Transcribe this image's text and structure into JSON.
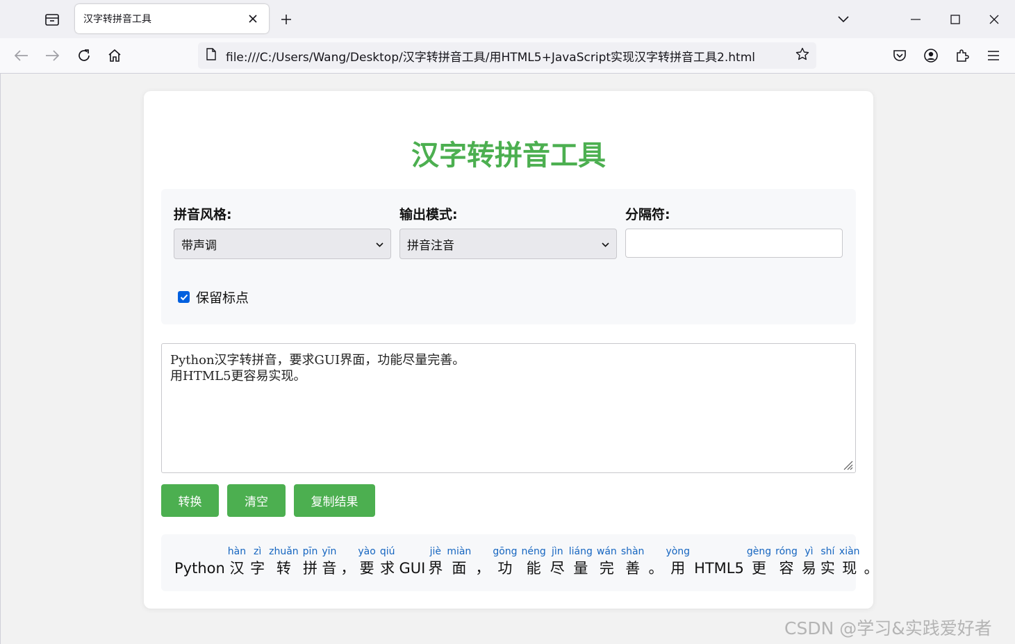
{
  "browser": {
    "tab_title": "汉字转拼音工具",
    "url": "file:///C:/Users/Wang/Desktop/汉字转拼音工具/用HTML5+JavaScript实现汉字转拼音工具2.html"
  },
  "app": {
    "title": "汉字转拼音工具",
    "style_label": "拼音风格:",
    "style_value": "带声调",
    "mode_label": "输出模式:",
    "mode_value": "拼音注音",
    "separator_label": "分隔符:",
    "separator_value": "",
    "keep_punct_label": "保留标点",
    "keep_punct_checked": true,
    "input_text": "Python汉字转拼音，要求GUI界面，功能尽量完善。\n用HTML5更容易实现。",
    "convert_button": "转换",
    "clear_button": "清空",
    "copy_button": "复制结果",
    "result": [
      {
        "t": "Python"
      },
      {
        "h": "汉",
        "p": "hàn"
      },
      {
        "h": "字",
        "p": "zì"
      },
      {
        "h": "转",
        "p": "zhuǎn"
      },
      {
        "h": "拼",
        "p": "pīn"
      },
      {
        "h": "音",
        "p": "yīn"
      },
      {
        "t": "，"
      },
      {
        "h": "要",
        "p": "yào"
      },
      {
        "h": "求",
        "p": "qiú"
      },
      {
        "t": "GUI"
      },
      {
        "h": "界",
        "p": "jiè"
      },
      {
        "h": "面",
        "p": "miàn"
      },
      {
        "t": "，"
      },
      {
        "h": "功",
        "p": "gōng"
      },
      {
        "h": "能",
        "p": "néng"
      },
      {
        "h": "尽",
        "p": "jìn"
      },
      {
        "h": "量",
        "p": "liáng"
      },
      {
        "h": "完",
        "p": "wán"
      },
      {
        "h": "善",
        "p": "shàn"
      },
      {
        "t": "。"
      },
      {
        "h": "用",
        "p": "yòng"
      },
      {
        "t": "HTML5"
      },
      {
        "h": "更",
        "p": "gèng"
      },
      {
        "h": "容",
        "p": "róng"
      },
      {
        "h": "易",
        "p": "yì"
      },
      {
        "h": "实",
        "p": "shí"
      },
      {
        "h": "现",
        "p": "xiàn"
      },
      {
        "t": "。"
      }
    ]
  },
  "watermark": "CSDN @学习&实践爱好者",
  "colors": {
    "accent": "#4caf50",
    "pinyin": "#1565c0",
    "checkbox": "#0060df"
  }
}
